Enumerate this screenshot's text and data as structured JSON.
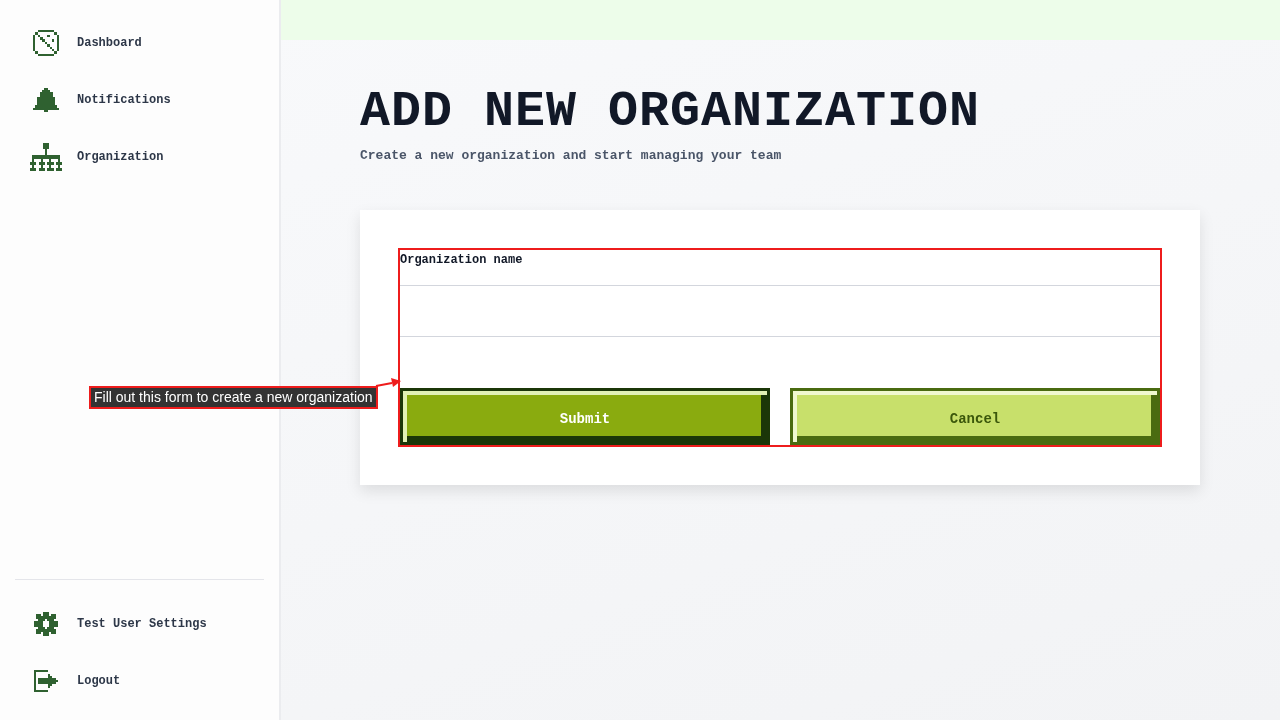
{
  "sidebar": {
    "items": [
      {
        "kind": "dashboard",
        "label": "Dashboard"
      },
      {
        "kind": "notifications",
        "label": "Notifications"
      },
      {
        "kind": "organization",
        "label": "Organization"
      }
    ],
    "footer_items": [
      {
        "kind": "settings",
        "label": "Test User Settings"
      },
      {
        "kind": "logout",
        "label": "Logout"
      }
    ]
  },
  "page": {
    "title": "ADD NEW ORGANIZATION",
    "subtitle": "Create a new organization and start managing your team"
  },
  "form": {
    "fields": [
      {
        "label": "Organization name"
      }
    ],
    "buttons": [
      {
        "kind": "primary",
        "label": "Submit"
      },
      {
        "kind": "secondary",
        "label": "Cancel"
      }
    ]
  },
  "annotation": {
    "text": "Fill out this form to create a new organization"
  }
}
